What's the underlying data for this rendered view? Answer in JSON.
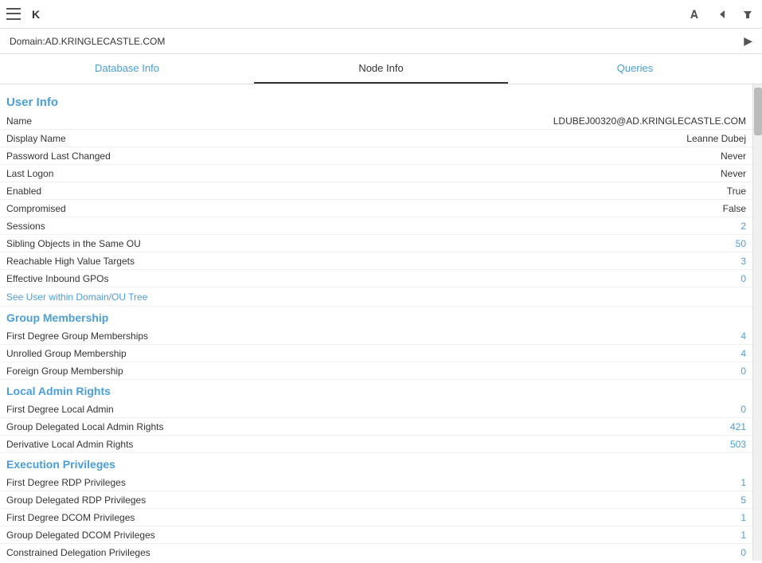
{
  "topbar": {
    "title": "K",
    "icons": [
      "A",
      "◀",
      "▽"
    ]
  },
  "breadcrumb": {
    "text": "Domain:AD.KRINGLECASTLE.COM",
    "arrow": "▶"
  },
  "tabs": [
    {
      "label": "Database Info",
      "state": "blue"
    },
    {
      "label": "Node Info",
      "state": "active"
    },
    {
      "label": "Queries",
      "state": "blue"
    }
  ],
  "userInfo": {
    "sectionLabel": "User Info",
    "rows": [
      {
        "label": "Name",
        "value": "LDUBEJ00320@AD.KRINGLECASTLE.COM",
        "type": "normal"
      },
      {
        "label": "Display Name",
        "value": "Leanne Dubej",
        "type": "normal"
      },
      {
        "label": "Password Last Changed",
        "value": "Never",
        "type": "normal"
      },
      {
        "label": "Last Logon",
        "value": "Never",
        "type": "normal"
      },
      {
        "label": "Enabled",
        "value": "True",
        "type": "normal"
      },
      {
        "label": "Compromised",
        "value": "False",
        "type": "normal"
      },
      {
        "label": "Sessions",
        "value": "2",
        "type": "blue"
      },
      {
        "label": "Sibling Objects in the Same OU",
        "value": "50",
        "type": "blue"
      },
      {
        "label": "Reachable High Value Targets",
        "value": "3",
        "type": "blue"
      },
      {
        "label": "Effective Inbound GPOs",
        "value": "0",
        "type": "blue"
      }
    ],
    "linkText": "See User within Domain/OU Tree"
  },
  "groupMembership": {
    "sectionLabel": "Group Membership",
    "rows": [
      {
        "label": "First Degree Group Memberships",
        "value": "4",
        "type": "blue"
      },
      {
        "label": "Unrolled Group Membership",
        "value": "4",
        "type": "blue"
      },
      {
        "label": "Foreign Group Membership",
        "value": "0",
        "type": "blue"
      }
    ]
  },
  "localAdminRights": {
    "sectionLabel": "Local Admin Rights",
    "rows": [
      {
        "label": "First Degree Local Admin",
        "value": "0",
        "type": "blue"
      },
      {
        "label": "Group Delegated Local Admin Rights",
        "value": "421",
        "type": "blue"
      },
      {
        "label": "Derivative Local Admin Rights",
        "value": "503",
        "type": "blue"
      }
    ]
  },
  "executionPrivileges": {
    "sectionLabel": "Execution Privileges",
    "rows": [
      {
        "label": "First Degree RDP Privileges",
        "value": "1",
        "type": "blue"
      },
      {
        "label": "Group Delegated RDP Privileges",
        "value": "5",
        "type": "blue"
      },
      {
        "label": "First Degree DCOM Privileges",
        "value": "1",
        "type": "blue"
      },
      {
        "label": "Group Delegated DCOM Privileges",
        "value": "1",
        "type": "blue"
      },
      {
        "label": "Constrained Delegation Privileges",
        "value": "0",
        "type": "blue"
      }
    ]
  }
}
